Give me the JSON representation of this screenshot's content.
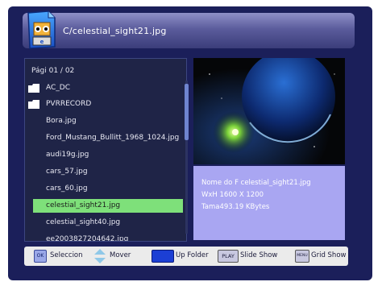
{
  "header": {
    "path": "C/celestial_sight21.jpg",
    "icon": "media-player-file-icon"
  },
  "browser": {
    "page_label": "Pági  01 / 02",
    "items": [
      {
        "label": "AC_DC",
        "type": "folder"
      },
      {
        "label": "PVRRECORD",
        "type": "folder"
      },
      {
        "label": "Bora.jpg",
        "type": "file"
      },
      {
        "label": "Ford_Mustang_Bullitt_1968_1024.jpg",
        "type": "file"
      },
      {
        "label": "audi19g.jpg",
        "type": "file"
      },
      {
        "label": "cars_57.jpg",
        "type": "file"
      },
      {
        "label": "cars_60.jpg",
        "type": "file"
      },
      {
        "label": "celestial_sight21.jpg",
        "type": "file",
        "selected": true
      },
      {
        "label": "celestial_sight40.jpg",
        "type": "file"
      },
      {
        "label": "ee2003827204642.jpg",
        "type": "file"
      }
    ]
  },
  "info": {
    "name_line": "Nome do F celestial_sight21.jpg",
    "size_line": "WxH  1600 X 1200",
    "filesize_line": "Tama493.19 KBytes"
  },
  "bottom": {
    "ok_key": "OK",
    "select_label": "Seleccion",
    "move_label": "Mover",
    "up_folder_label": "Up Folder",
    "play_key": "PLAY",
    "slideshow_label": "Slide Show",
    "menu_key": "MENU",
    "grid_label": "Grid Show"
  },
  "colors": {
    "selected_row": "#7ee07a",
    "info_panel": "#a9a6f2",
    "up_folder_key": "#1c3fd4"
  }
}
